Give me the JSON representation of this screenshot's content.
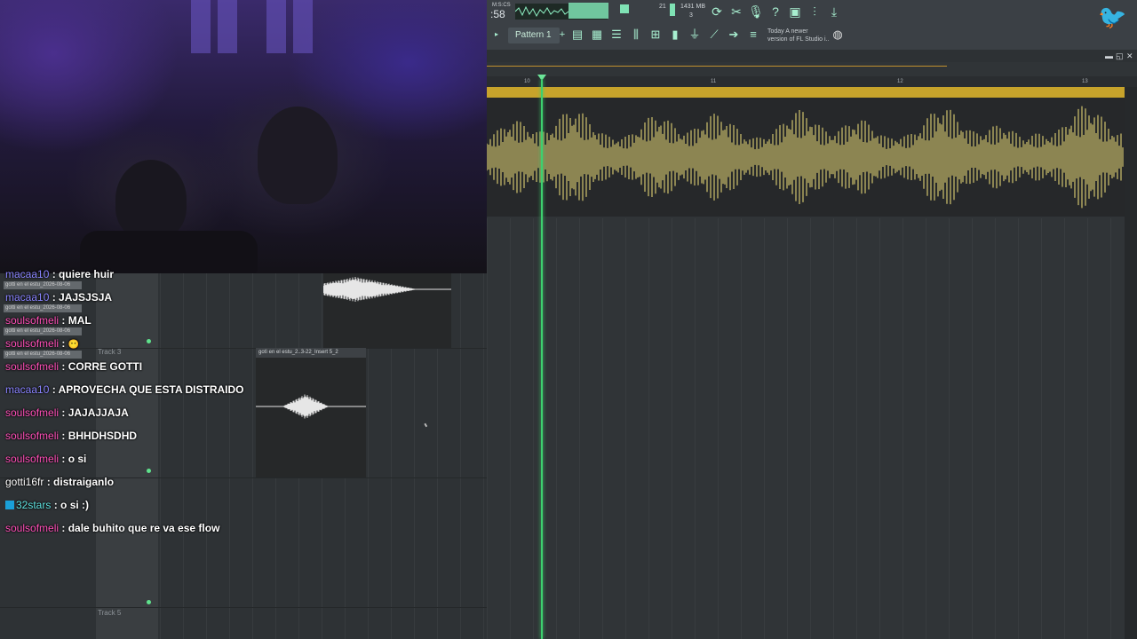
{
  "toolbar": {
    "time_display": ":58",
    "cpu_readout": "21",
    "memory_readout": "1431 MB",
    "polyphony_readout": "3",
    "pattern_label": "Pattern 1",
    "news_date": "Today",
    "news_line1": "A newer",
    "news_line2": "version of FL Studio i..",
    "accent_color": "#7fe2b4"
  },
  "playlist": {
    "ruler_bars": [
      "10",
      "11",
      "12",
      "13"
    ],
    "clip_color": "#c7a32b",
    "wave_color": "#f3e27a",
    "playhead_color": "#3dd06e"
  },
  "tracks": {
    "track3_label": "Track 3",
    "track5_label": "Track 5",
    "clip2_name": "gotì en el estu_2..3-22_Insert 5_2"
  },
  "notifications": [
    "gotti en el estu_2026-08-06",
    "gotti en el estu_2026-08-06",
    "gotti en el estu_2026-08-06",
    "gotti en el estu_2026-08-06"
  ],
  "chat": [
    {
      "user": "macaa10",
      "text": "quiere huir",
      "color": "#8a84ff"
    },
    {
      "user": "macaa10",
      "text": "JAJSJSJA",
      "color": "#8a84ff"
    },
    {
      "user": "soulsofmeli",
      "text": "MAL",
      "color": "#ff4fb8"
    },
    {
      "user": "soulsofmeli",
      "text": "",
      "color": "#ff4fb8"
    },
    {
      "user": "soulsofmeli",
      "text": "CORRE GOTTI",
      "color": "#ff4fb8"
    },
    {
      "user": "macaa10",
      "text": "APROVECHA QUE ESTA DISTRAIDO",
      "color": "#8a84ff"
    },
    {
      "user": "soulsofmeli",
      "text": "JAJAJJAJA",
      "color": "#ff4fb8"
    },
    {
      "user": "soulsofmeli",
      "text": "BHHDHSDHD",
      "color": "#ff4fb8"
    },
    {
      "user": "soulsofmeli",
      "text": "o si",
      "color": "#ff4fb8"
    },
    {
      "user": "gotti16fr",
      "text": "distraiganlo",
      "color": "#ffffff"
    },
    {
      "user": "32stars",
      "text": "o si :)",
      "color": "#5fe3e0"
    },
    {
      "user": "soulsofmeli",
      "text": "dale buhito que re va ese flow",
      "color": "#ff4fb8"
    }
  ]
}
